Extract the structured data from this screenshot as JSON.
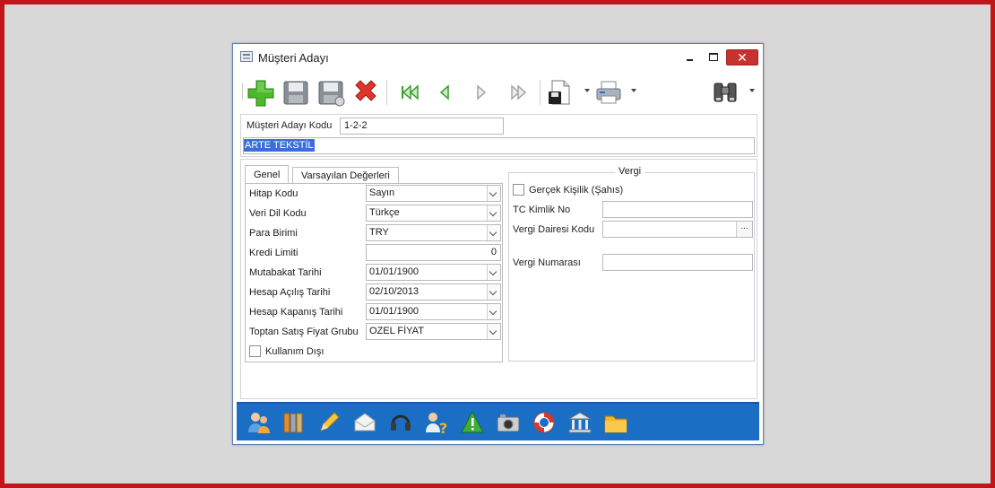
{
  "window": {
    "title": "Müşteri Adayı",
    "close_glyph": "✕"
  },
  "toolbar": {
    "icons": [
      "add-icon",
      "save-icon",
      "save-as-icon",
      "delete-icon",
      "first-record-icon",
      "previous-record-icon",
      "next-record-icon",
      "last-record-icon",
      "save-document-icon",
      "print-icon",
      "binoculars-icon"
    ]
  },
  "header": {
    "code_label": "Müşteri Adayı Kodu",
    "code_value": "1-2-2",
    "name_value": "ARTE TEKSTİL"
  },
  "tabs": [
    {
      "label": "Genel",
      "active": true
    },
    {
      "label": "Varsayılan Değerleri",
      "active": false
    }
  ],
  "genel": {
    "hitap_label": "Hitap Kodu",
    "hitap_value": "Sayın",
    "veridil_label": "Veri Dil Kodu",
    "veridil_value": "Türkçe",
    "para_label": "Para Birimi",
    "para_value": "TRY",
    "kredi_label": "Kredi Limiti",
    "kredi_value": "0",
    "mutabakat_label": "Mutabakat Tarihi",
    "mutabakat_value": "01/01/1900",
    "acilis_label": "Hesap Açılış Tarihi",
    "acilis_value": "02/10/2013",
    "kapanis_label": "Hesap Kapanış Tarihi",
    "kapanis_value": "01/01/1900",
    "toptan_label": "Toptan Satış Fiyat Grubu",
    "toptan_value": "OZEL FİYAT",
    "kullanim_label": "Kullanım Dışı"
  },
  "vergi": {
    "title": "Vergi",
    "gercek_label": "Gerçek Kişilik (Şahıs)",
    "tc_label": "TC Kimlik No",
    "tc_value": "",
    "daire_label": "Vergi Dairesi Kodu",
    "daire_value": "",
    "daire_button": "...",
    "numara_label": "Vergi Numarası",
    "numara_value": ""
  },
  "bottom_icons": [
    "contacts-icon",
    "binders-icon",
    "pencil-icon",
    "envelope-icon",
    "headset-icon",
    "help-person-icon",
    "warning-icon",
    "camera-icon",
    "lifebuoy-icon",
    "bank-icon",
    "folder-icon"
  ],
  "colors": {
    "bottom_bar": "#1a6fc4",
    "close_button": "#c7332c",
    "frame": "#c0161a",
    "selection": "#3a6fd8"
  }
}
